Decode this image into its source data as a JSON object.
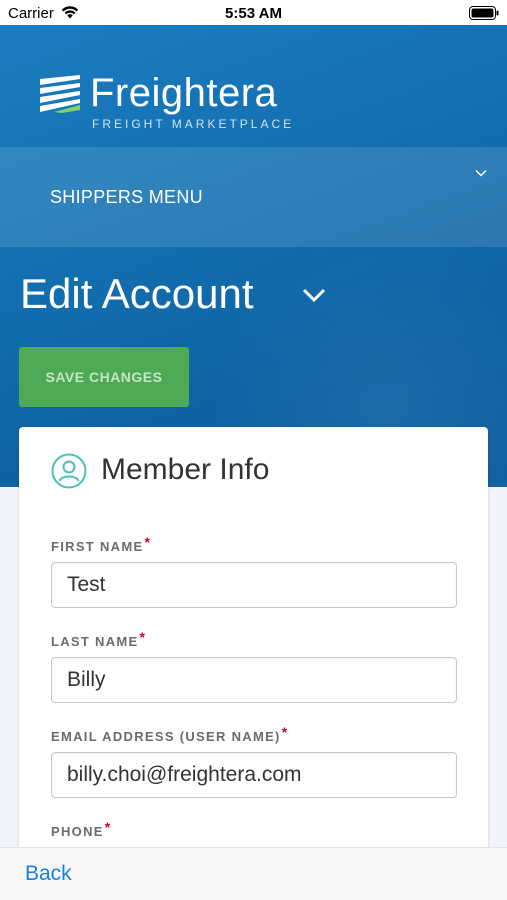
{
  "status_bar": {
    "carrier": "Carrier",
    "time": "5:53 AM"
  },
  "header": {
    "brand": "Freightera",
    "tagline": "FREIGHT MARKETPLACE",
    "menu_label": "SHIPPERS MENU"
  },
  "page": {
    "title": "Edit Account",
    "save_label": "SAVE CHANGES"
  },
  "card": {
    "title": "Member Info",
    "fields": [
      {
        "label": "FIRST NAME",
        "required": "*",
        "value": "Test"
      },
      {
        "label": "LAST NAME",
        "required": "*",
        "value": "Billy"
      },
      {
        "label": "EMAIL ADDRESS (USER NAME)",
        "required": "*",
        "value": "billy.choi@freightera.com"
      },
      {
        "label": "PHONE",
        "required": "*"
      }
    ]
  },
  "tab_bar": {
    "back_label": "Back"
  },
  "colors": {
    "header_blue": "#1671b3",
    "save_green": "#4faa55",
    "required_red": "#d0021b",
    "link_blue": "#1a7fe0",
    "member_icon_teal": "#4cbfb6"
  },
  "icons": [
    "wifi-icon",
    "battery-icon",
    "freightera-logo-icon",
    "chevron-down-icon",
    "member-icon"
  ]
}
